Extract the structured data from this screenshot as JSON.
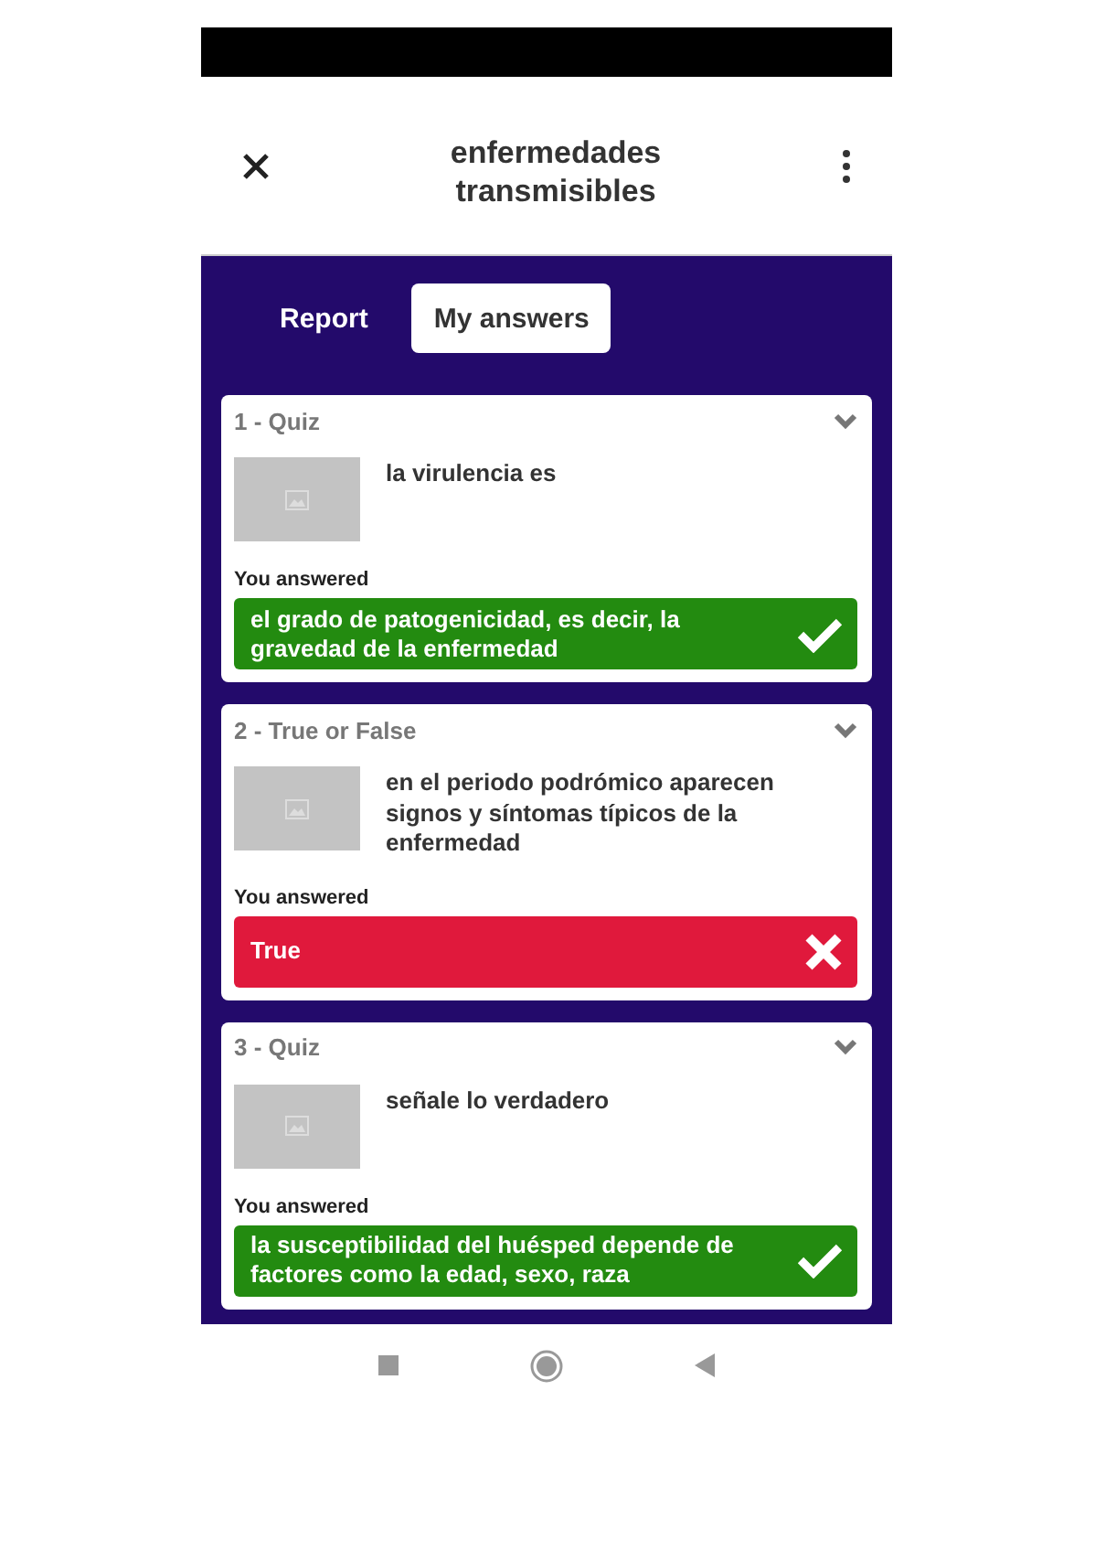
{
  "header": {
    "title": "enfermedades transmisibles"
  },
  "tabs": [
    {
      "label": "Report",
      "selected": false
    },
    {
      "label": "My answers",
      "selected": true
    }
  ],
  "questions": [
    {
      "heading": "1 - Quiz",
      "question": "la virulencia es",
      "answer_label": "You answered",
      "answer": "el grado de patogenicidad, es decir, la gravedad de la enfermedad",
      "correct": true
    },
    {
      "heading": "2 - True or False",
      "question": "en el periodo podrómico aparecen signos y síntomas típicos de la enfermedad",
      "answer_label": "You answered",
      "answer": "True",
      "correct": false
    },
    {
      "heading": "3 - Quiz",
      "question": "señale lo verdadero",
      "answer_label": "You answered",
      "answer": "la susceptibilidad del huésped depende de factores como la edad, sexo, raza",
      "correct": true
    }
  ]
}
